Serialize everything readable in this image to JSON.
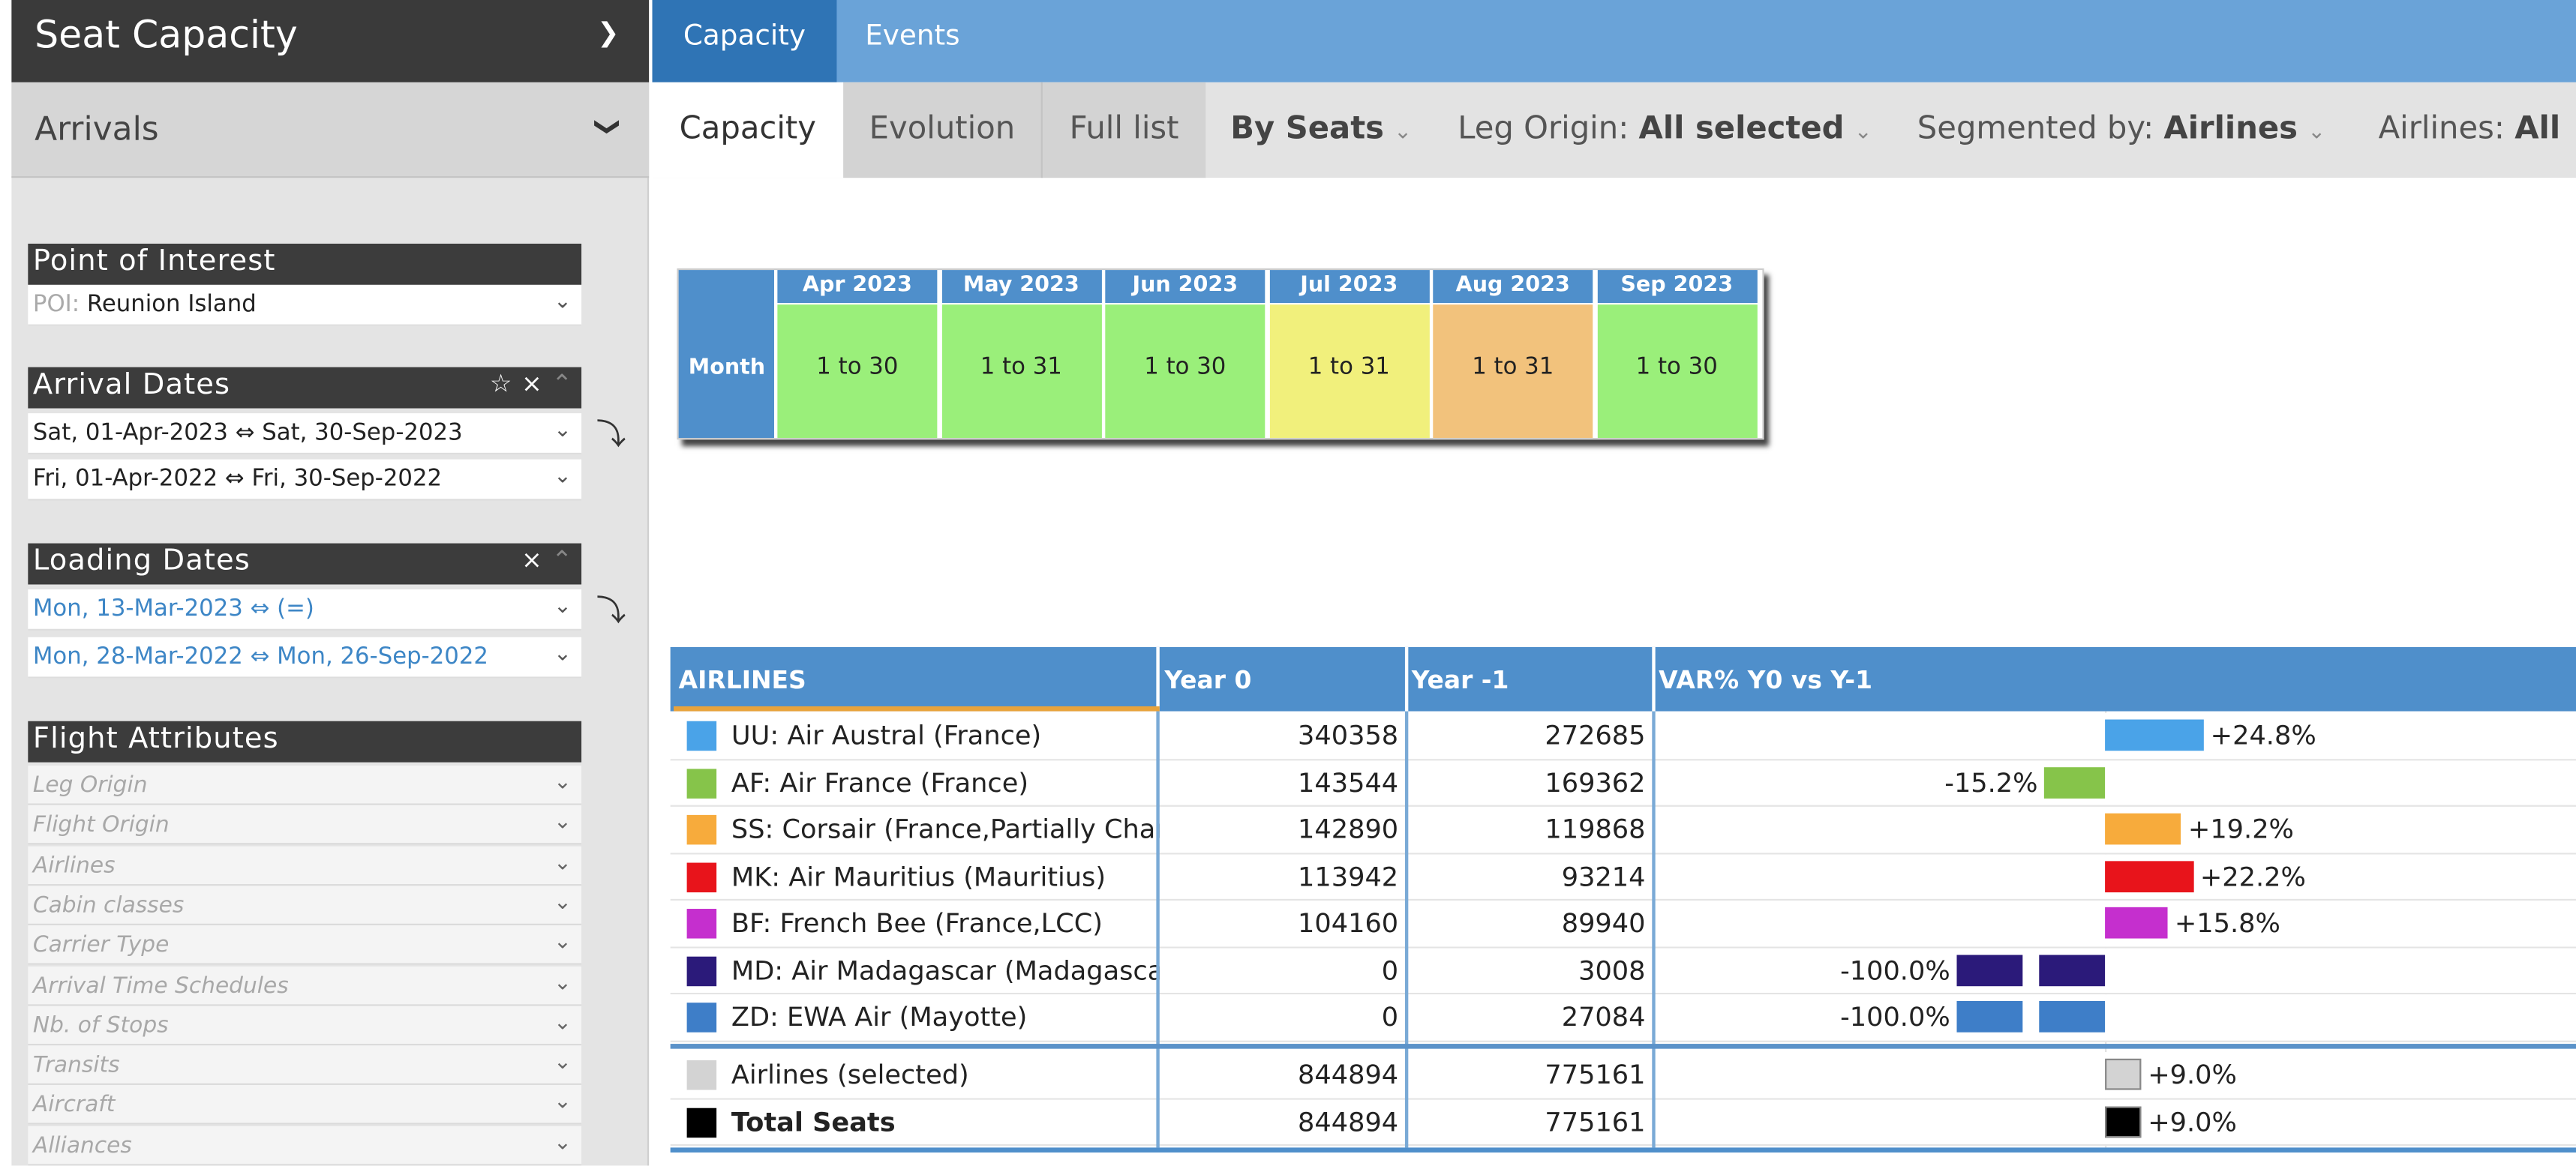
{
  "sidebar": {
    "title": "Seat Capacity",
    "subtitle": "Arrivals",
    "poi": {
      "header": "Point of Interest",
      "prefix": "POI:",
      "value": "Reunion Island"
    },
    "arrival": {
      "header": "Arrival Dates",
      "row1": "Sat,  01-Apr-2023  ⇔ Sat,  30-Sep-2023",
      "row2": "Fri,  01-Apr-2022  ⇔ Fri,  30-Sep-2022"
    },
    "loading": {
      "header": "Loading Dates",
      "row1": "Mon, 13-Mar-2023  ⇔ (=)",
      "row2": "Mon, 28-Mar-2022  ⇔ Mon, 26-Sep-2022"
    },
    "attributes": {
      "header": "Flight Attributes",
      "items": [
        "Leg Origin",
        "Flight Origin",
        "Airlines",
        "Cabin classes",
        "Carrier Type",
        "Arrival Time Schedules",
        "Nb. of Stops",
        "Transits",
        "Aircraft",
        "Alliances"
      ]
    }
  },
  "top_tabs": {
    "capacity": "Capacity",
    "events": "Events"
  },
  "sub_tabs": {
    "capacity": "Capacity",
    "evolution": "Evolution",
    "full_list": "Full list"
  },
  "filters": {
    "by": "By Seats",
    "leg_origin_label": "Leg Origin:",
    "leg_origin_value": "All selected",
    "segmented_label": "Segmented by:",
    "segmented_value": "Airlines",
    "airlines_label": "Airlines:",
    "airlines_value": "All"
  },
  "months": {
    "row_label": "Month",
    "items": [
      {
        "name": "Apr 2023",
        "range": "1 to 30",
        "color": "#9aef7a"
      },
      {
        "name": "May 2023",
        "range": "1 to 31",
        "color": "#9aef7a"
      },
      {
        "name": "Jun 2023",
        "range": "1 to 30",
        "color": "#9aef7a"
      },
      {
        "name": "Jul 2023",
        "range": "1 to 31",
        "color": "#f1f07c"
      },
      {
        "name": "Aug 2023",
        "range": "1 to 31",
        "color": "#f2c27c"
      },
      {
        "name": "Sep 2023",
        "range": "1 to 30",
        "color": "#9aef7a"
      }
    ]
  },
  "table": {
    "headers": {
      "airlines": "AIRLINES",
      "year0": "Year 0",
      "year1": "Year -1",
      "var": "VAR% Y0 vs Y-1"
    },
    "rows": [
      {
        "name": "UU: Air Austral (France)",
        "year0": "340358",
        "year1": "272685",
        "var": "+24.8%",
        "var_pct": 24.8,
        "color": "#4aa3e8"
      },
      {
        "name": "AF: Air France (France)",
        "year0": "143544",
        "year1": "169362",
        "var": "-15.2%",
        "var_pct": -15.2,
        "color": "#86c44a"
      },
      {
        "name": "SS: Corsair (France,Partially Char",
        "year0": "142890",
        "year1": "119868",
        "var": "+19.2%",
        "var_pct": 19.2,
        "color": "#f7ab3c"
      },
      {
        "name": "MK: Air Mauritius (Mauritius)",
        "year0": "113942",
        "year1": "93214",
        "var": "+22.2%",
        "var_pct": 22.2,
        "color": "#e8141b"
      },
      {
        "name": "BF: French Bee (France,LCC)",
        "year0": "104160",
        "year1": "89940",
        "var": "+15.8%",
        "var_pct": 15.8,
        "color": "#c52fce"
      },
      {
        "name": "MD: Air Madagascar (Madagasca",
        "year0": "0",
        "year1": "3008",
        "var": "-100.0%",
        "var_pct": -100.0,
        "color": "#2b1a7a"
      },
      {
        "name": "ZD: EWA Air (Mayotte)",
        "year0": "0",
        "year1": "27084",
        "var": "-100.0%",
        "var_pct": -100.0,
        "color": "#3e7ec8"
      }
    ],
    "totals": [
      {
        "name": "Airlines (selected)",
        "year0": "844894",
        "year1": "775161",
        "var": "+9.0%",
        "var_pct": 9.0,
        "color": "#d3d3d3",
        "bold": false
      },
      {
        "name": "Total Seats",
        "year0": "844894",
        "year1": "775161",
        "var": "+9.0%",
        "var_pct": 9.0,
        "color": "#000000",
        "bold": true
      }
    ]
  }
}
